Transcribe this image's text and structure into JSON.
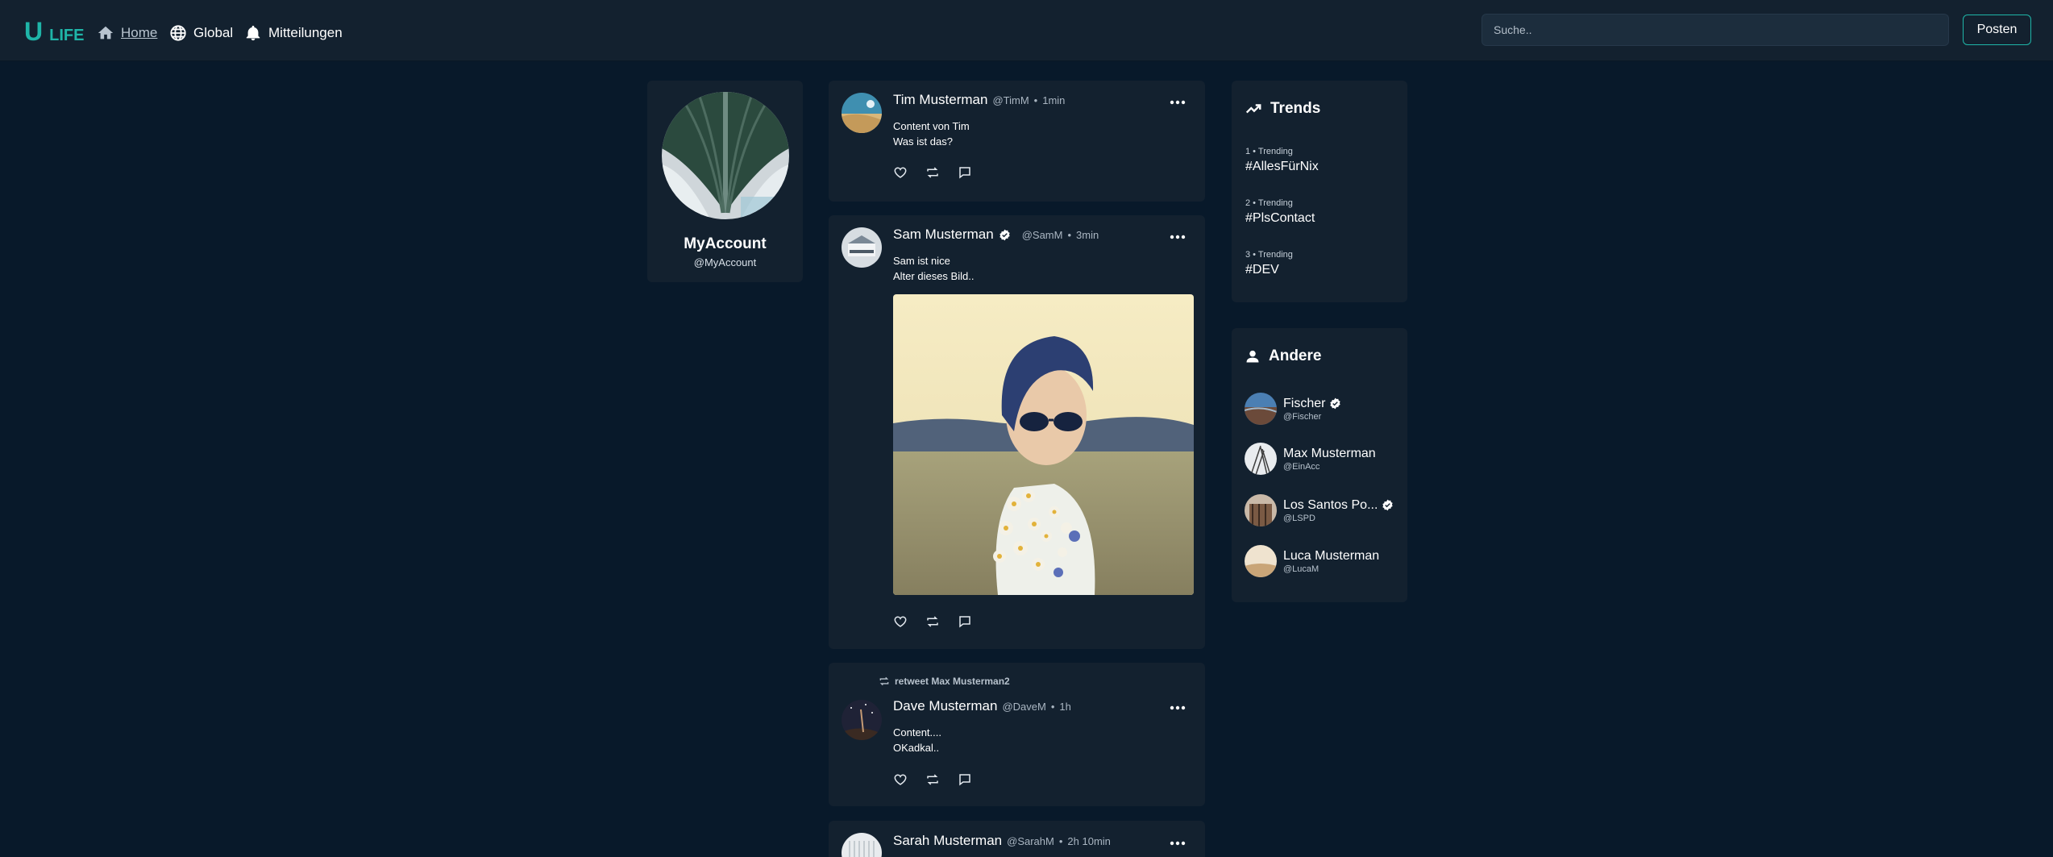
{
  "brand": {
    "logo_u": "U",
    "logo_life": "LIFE",
    "accent_color": "#1fb5a8"
  },
  "nav": {
    "items": [
      {
        "label": "Home",
        "icon": "home-icon",
        "active": true
      },
      {
        "label": "Global",
        "icon": "globe-icon",
        "active": false
      },
      {
        "label": "Mitteilungen",
        "icon": "bell-icon",
        "active": false
      }
    ],
    "search_placeholder": "Suche..",
    "post_button": "Posten"
  },
  "profile": {
    "name": "MyAccount",
    "handle": "@MyAccount"
  },
  "posts": [
    {
      "author": "Tim Musterman",
      "verified": false,
      "handle": "@TimM",
      "time": "1min",
      "lines": [
        "Content von Tim",
        "Was ist das?"
      ]
    },
    {
      "author": "Sam Musterman",
      "verified": true,
      "handle": "@SamM",
      "time": "3min",
      "lines": [
        "Sam ist nice",
        "Alter dieses Bild.."
      ],
      "has_image": true
    },
    {
      "retweet_label": "retweet Max Musterman2",
      "author": "Dave Musterman",
      "verified": false,
      "handle": "@DaveM",
      "time": "1h",
      "lines": [
        "Content....",
        "OKadkal.."
      ]
    },
    {
      "author": "Sarah Musterman",
      "verified": false,
      "handle": "@SarahM",
      "time": "2h 10min",
      "lines": []
    }
  ],
  "trends": {
    "title": "Trends",
    "items": [
      {
        "meta": "1 • Trending",
        "tag": "#AllesFürNix"
      },
      {
        "meta": "2 • Trending",
        "tag": "#PlsContact"
      },
      {
        "meta": "3 • Trending",
        "tag": "#DEV"
      }
    ]
  },
  "others": {
    "title": "Andere",
    "users": [
      {
        "name": "Fischer",
        "handle": "@Fischer",
        "verified": true
      },
      {
        "name": "Max Musterman",
        "handle": "@EinAcc",
        "verified": false
      },
      {
        "name": "Los Santos Po...",
        "handle": "@LSPD",
        "verified": true
      },
      {
        "name": "Luca Musterman",
        "handle": "@LucaM",
        "verified": false
      }
    ]
  }
}
